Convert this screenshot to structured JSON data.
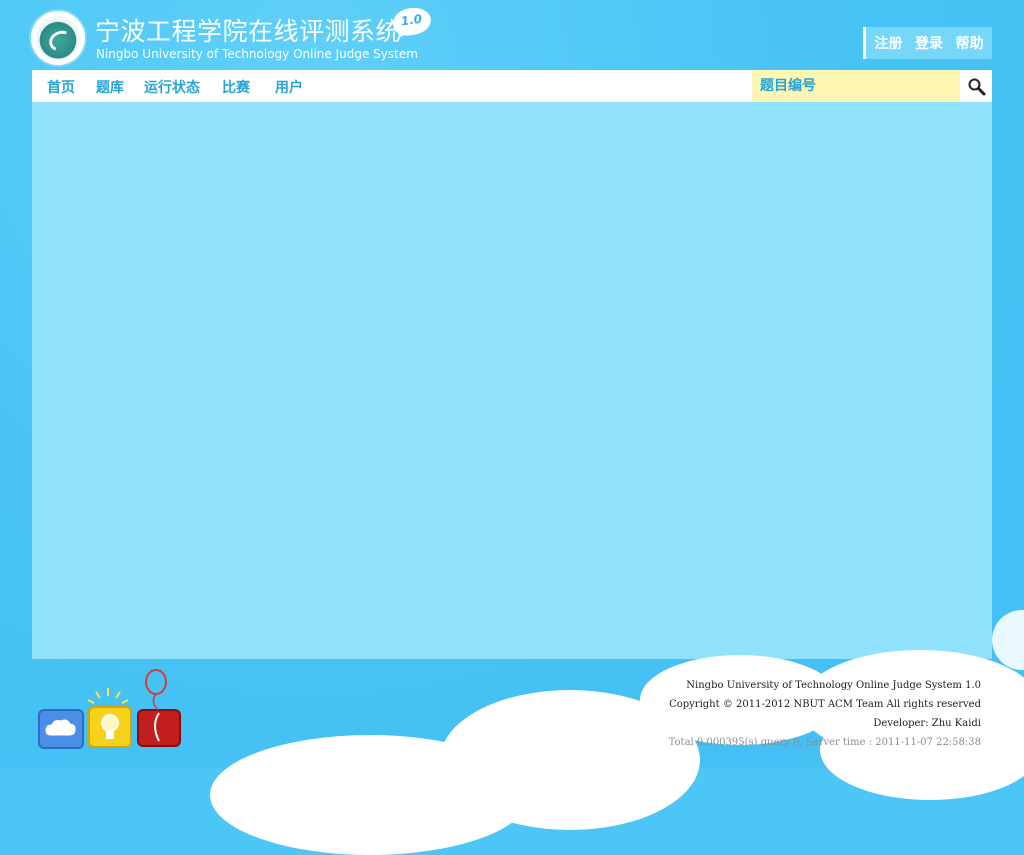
{
  "header": {
    "title_cn": "宁波工程学院在线评测系统",
    "title_en": "Ningbo University of Technology Online Judge System",
    "version": "1.0",
    "logo_icon": "school-emblem-icon"
  },
  "user_links": [
    {
      "label": "注册"
    },
    {
      "label": "登录"
    },
    {
      "label": "帮助"
    }
  ],
  "nav": {
    "items": [
      {
        "label": "首页"
      },
      {
        "label": "题库"
      },
      {
        "label": "运行状态"
      },
      {
        "label": "比赛"
      },
      {
        "label": "用户"
      }
    ],
    "search": {
      "placeholder": "题目编号",
      "value": ""
    },
    "search_icon": "magnifier-icon"
  },
  "footer": {
    "line1": "Ningbo University of Technology Online Judge System 1.0",
    "line2": "Copyright © 2011-2012 NBUT ACM Team All rights reserved",
    "line3": "Developer: Zhu Kaidi",
    "line4": "Total 0.000395(s) query 0, Server time : 2011-11-07 22:58:38"
  },
  "footer_icons": [
    "chat-cloud-icon",
    "lightbulb-icon",
    "balloon-icon"
  ],
  "colors": {
    "page_bg": "#4cc6f6",
    "content_bg": "#8fe1fc",
    "nav_bg": "#ffffff",
    "nav_text": "#28a4d8",
    "search_bg": "#fdf7b3"
  }
}
